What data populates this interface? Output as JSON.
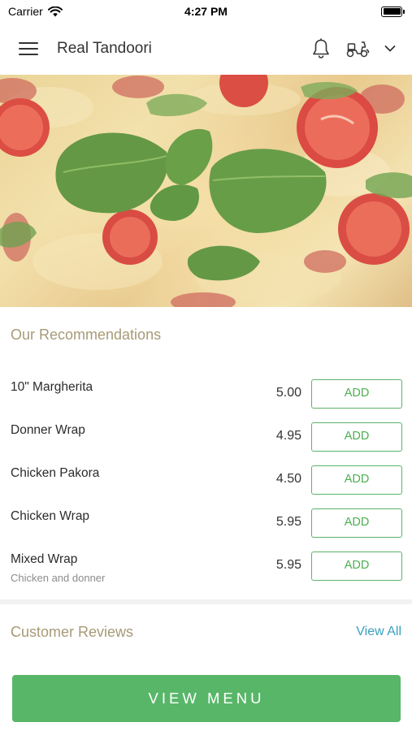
{
  "status_bar": {
    "carrier": "Carrier",
    "time": "4:27 PM"
  },
  "header": {
    "title": "Real Tandoori"
  },
  "hero": {
    "icon": "pizza-photo"
  },
  "recommendations": {
    "title": "Our Recommendations",
    "items": [
      {
        "name": "10\" Margherita",
        "description": "",
        "price": "5.00",
        "button": "ADD"
      },
      {
        "name": "Donner Wrap",
        "description": "",
        "price": "4.95",
        "button": "ADD"
      },
      {
        "name": "Chicken Pakora",
        "description": "",
        "price": "4.50",
        "button": "ADD"
      },
      {
        "name": "Chicken Wrap",
        "description": "",
        "price": "5.95",
        "button": "ADD"
      },
      {
        "name": "Mixed Wrap",
        "description": "Chicken and donner",
        "price": "5.95",
        "button": "ADD"
      }
    ]
  },
  "reviews": {
    "title": "Customer Reviews",
    "view_all": "View All"
  },
  "footer": {
    "button": "VIEW MENU"
  },
  "colors": {
    "accent_green": "#58b668",
    "link_blue": "#3aa0c0",
    "section_title": "#a79a76"
  }
}
